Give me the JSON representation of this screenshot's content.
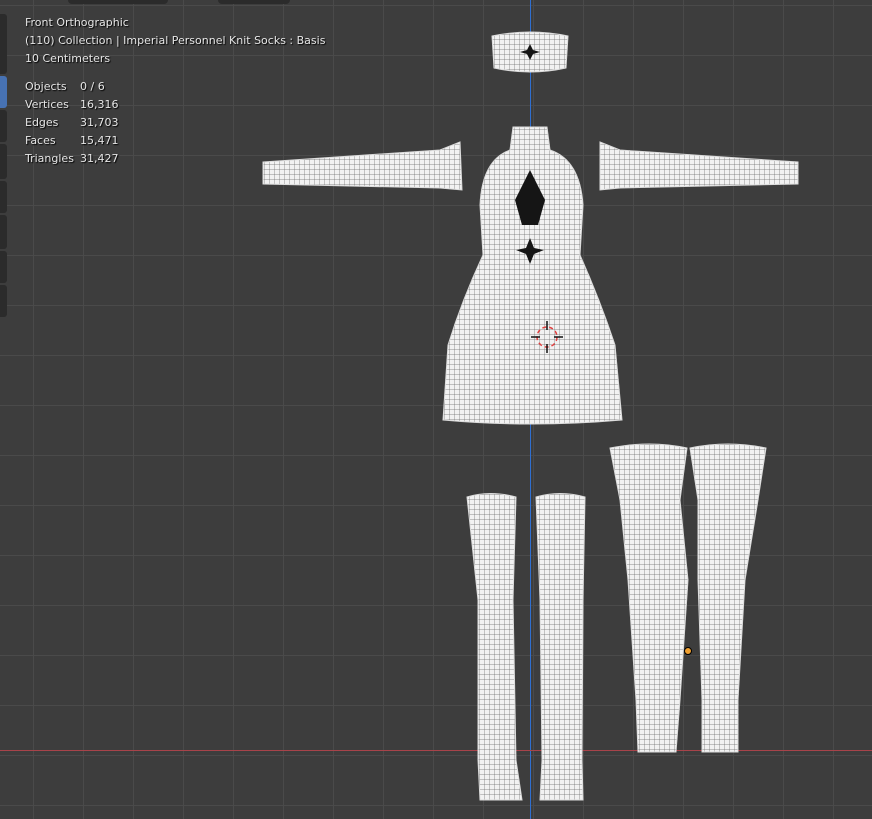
{
  "viewport": {
    "view_name": "Front Orthographic",
    "collection_info": "(110) Collection | Imperial Personnel Knit Socks : Basis",
    "scale": "10 Centimeters",
    "stats": [
      {
        "label": "Objects",
        "value": "0 / 6"
      },
      {
        "label": "Vertices",
        "value": "16,316"
      },
      {
        "label": "Edges",
        "value": "31,703"
      },
      {
        "label": "Faces",
        "value": "15,471"
      },
      {
        "label": "Triangles",
        "value": "31,427"
      }
    ]
  },
  "colors": {
    "x_axis": "#a8434a",
    "y_axis": "#2f6fd0",
    "background": "#3d3d3d",
    "active_tool": "#4772b3",
    "origin": "#f0a030"
  }
}
